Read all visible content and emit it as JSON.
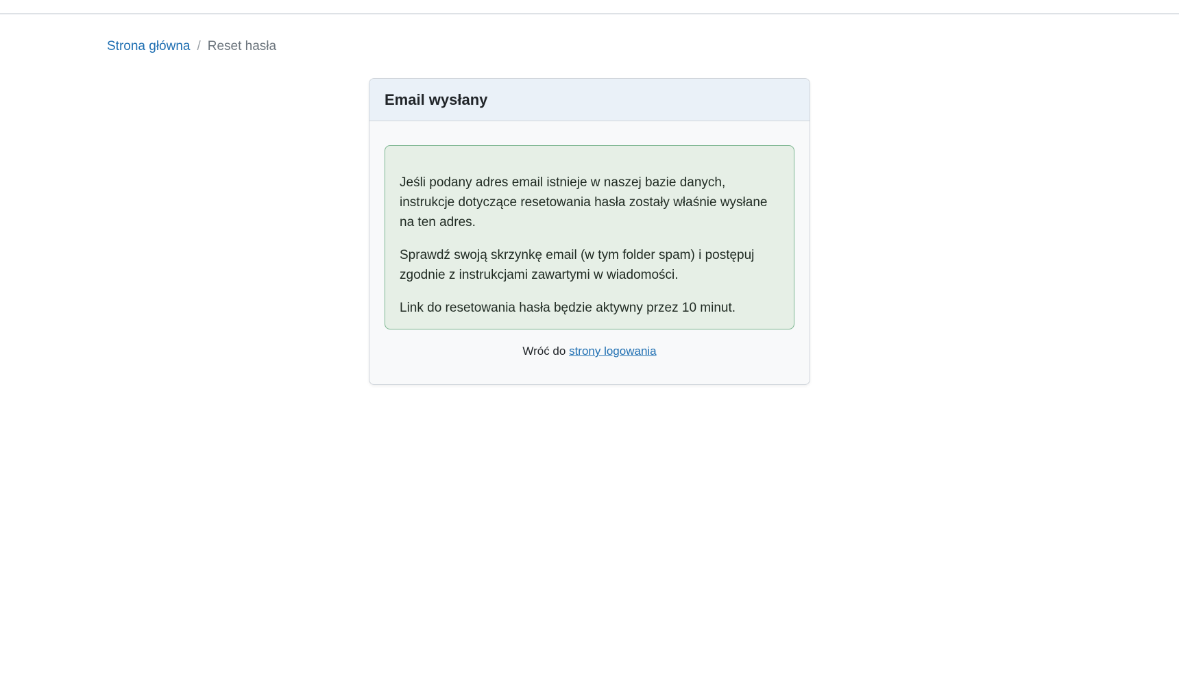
{
  "breadcrumb": {
    "home_label": "Strona główna",
    "separator": "/",
    "current_label": "Reset hasła"
  },
  "card": {
    "title": "Email wysłany",
    "alert_paragraphs": [
      "Jeśli podany adres email istnieje w naszej bazie danych, instrukcje dotyczące resetowania hasła zostały właśnie wysłane na ten adres.",
      "Sprawdź swoją skrzynkę email (w tym folder spam) i postępuj zgodnie z instrukcjami zawartymi w wiadomości.",
      "Link do resetowania hasła będzie aktywny przez 10 minut."
    ],
    "back_prefix": "Wróć do ",
    "back_link_label": "strony logowania"
  },
  "colors": {
    "link": "#1f6fb2",
    "alert_bg": "#e6efe6",
    "alert_border": "#7bb58f",
    "header_bg": "#eaf1f8"
  }
}
